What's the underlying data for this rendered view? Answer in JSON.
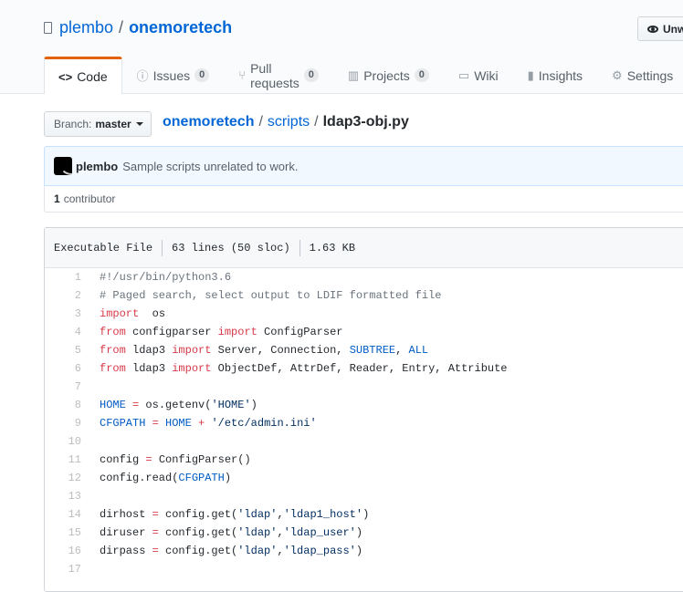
{
  "repo": {
    "owner": "plembo",
    "separator": "/",
    "name": "onemoretech"
  },
  "watch_button": {
    "label": "Unwatch"
  },
  "tabs": [
    {
      "label": "Code",
      "icon": "code-icon",
      "glyph": "<>"
    },
    {
      "label": "Issues",
      "count": "0",
      "icon": "issue-icon",
      "glyph": "ⓘ"
    },
    {
      "label": "Pull requests",
      "count": "0",
      "icon": "pull-request-icon",
      "glyph": "⑂"
    },
    {
      "label": "Projects",
      "count": "0",
      "icon": "project-icon",
      "glyph": "▥"
    },
    {
      "label": "Wiki",
      "icon": "book-icon",
      "glyph": "▭"
    },
    {
      "label": "Insights",
      "icon": "graph-icon",
      "glyph": "▮"
    },
    {
      "label": "Settings",
      "icon": "gear-icon",
      "glyph": "⚙"
    }
  ],
  "branch": {
    "label": "Branch:",
    "name": "master"
  },
  "breadcrumb": {
    "root": "onemoretech",
    "dir": "scripts",
    "file": "ldap3-obj.py",
    "sep": "/"
  },
  "commit": {
    "author": "plembo",
    "message": "Sample scripts unrelated to work."
  },
  "contributors": {
    "count": "1",
    "label": "contributor"
  },
  "file_info": {
    "mode": "Executable File",
    "lines": "63 lines (50 sloc)",
    "size": "1.63 KB"
  },
  "code_lines": [
    [
      [
        "c",
        "#!/usr/bin/python3.6"
      ]
    ],
    [
      [
        "c",
        "# Paged search, select output to LDIF formatted file"
      ]
    ],
    [
      [
        "k",
        "import"
      ],
      [
        "",
        "  os"
      ]
    ],
    [
      [
        "k",
        "from"
      ],
      [
        "",
        " configparser "
      ],
      [
        "k",
        "import"
      ],
      [
        "",
        " ConfigParser"
      ]
    ],
    [
      [
        "k",
        "from"
      ],
      [
        "",
        " ldap3 "
      ],
      [
        "k",
        "import"
      ],
      [
        "",
        " Server, Connection, "
      ],
      [
        "v",
        "SUBTREE"
      ],
      [
        "",
        ", "
      ],
      [
        "v",
        "ALL"
      ]
    ],
    [
      [
        "k",
        "from"
      ],
      [
        "",
        " ldap3 "
      ],
      [
        "k",
        "import"
      ],
      [
        "",
        " ObjectDef, AttrDef, Reader, Entry, Attribute"
      ]
    ],
    [],
    [
      [
        "v",
        "HOME"
      ],
      [
        "",
        " "
      ],
      [
        "k",
        "="
      ],
      [
        "",
        " os.getenv("
      ],
      [
        "s",
        "'HOME'"
      ],
      [
        "",
        ")"
      ]
    ],
    [
      [
        "v",
        "CFGPATH"
      ],
      [
        "",
        " "
      ],
      [
        "k",
        "="
      ],
      [
        "",
        " "
      ],
      [
        "v",
        "HOME"
      ],
      [
        "",
        " "
      ],
      [
        "k",
        "+"
      ],
      [
        "",
        " "
      ],
      [
        "s",
        "'/etc/admin.ini'"
      ]
    ],
    [],
    [
      [
        "",
        "config "
      ],
      [
        "k",
        "="
      ],
      [
        "",
        " ConfigParser()"
      ]
    ],
    [
      [
        "",
        "config.read("
      ],
      [
        "v",
        "CFGPATH"
      ],
      [
        "",
        ")"
      ]
    ],
    [],
    [
      [
        "",
        "dirhost "
      ],
      [
        "k",
        "="
      ],
      [
        "",
        " config.get("
      ],
      [
        "s",
        "'ldap'"
      ],
      [
        "",
        ","
      ],
      [
        "s",
        "'ldap1_host'"
      ],
      [
        "",
        ")"
      ]
    ],
    [
      [
        "",
        "diruser "
      ],
      [
        "k",
        "="
      ],
      [
        "",
        " config.get("
      ],
      [
        "s",
        "'ldap'"
      ],
      [
        "",
        ","
      ],
      [
        "s",
        "'ldap_user'"
      ],
      [
        "",
        ")"
      ]
    ],
    [
      [
        "",
        "dirpass "
      ],
      [
        "k",
        "="
      ],
      [
        "",
        " config.get("
      ],
      [
        "s",
        "'ldap'"
      ],
      [
        "",
        ","
      ],
      [
        "s",
        "'ldap_pass'"
      ],
      [
        "",
        ")"
      ]
    ],
    []
  ]
}
